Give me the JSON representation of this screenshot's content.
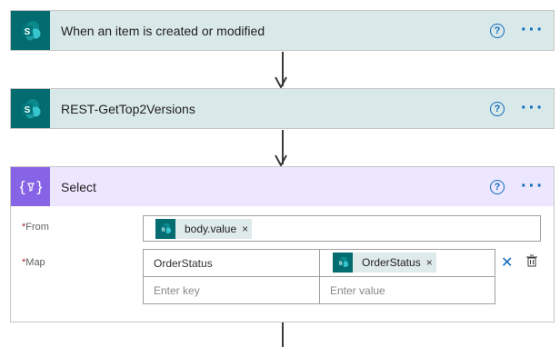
{
  "steps": [
    {
      "title": "When an item is created or modified",
      "icon": "sharepoint-icon"
    },
    {
      "title": "REST-GetTop2Versions",
      "icon": "sharepoint-icon"
    }
  ],
  "select": {
    "title": "Select",
    "icon": "data-operations-icon",
    "from_label": "From",
    "from_token": "body.value",
    "map_label": "Map",
    "required_mark": "*",
    "rows": [
      {
        "key": "OrderStatus",
        "value_token": "OrderStatus"
      }
    ],
    "key_placeholder": "Enter key",
    "value_placeholder": "Enter value"
  },
  "help_glyph": "?",
  "more_glyph": "···",
  "remove_glyph": "×",
  "colors": {
    "sharepoint_tile": "#036c70",
    "sharepoint_header": "#d9e8e8",
    "select_tile": "#8764e6",
    "select_header": "#ede6ff",
    "link_blue": "#0f6cbd",
    "required_red": "#a4262c"
  }
}
